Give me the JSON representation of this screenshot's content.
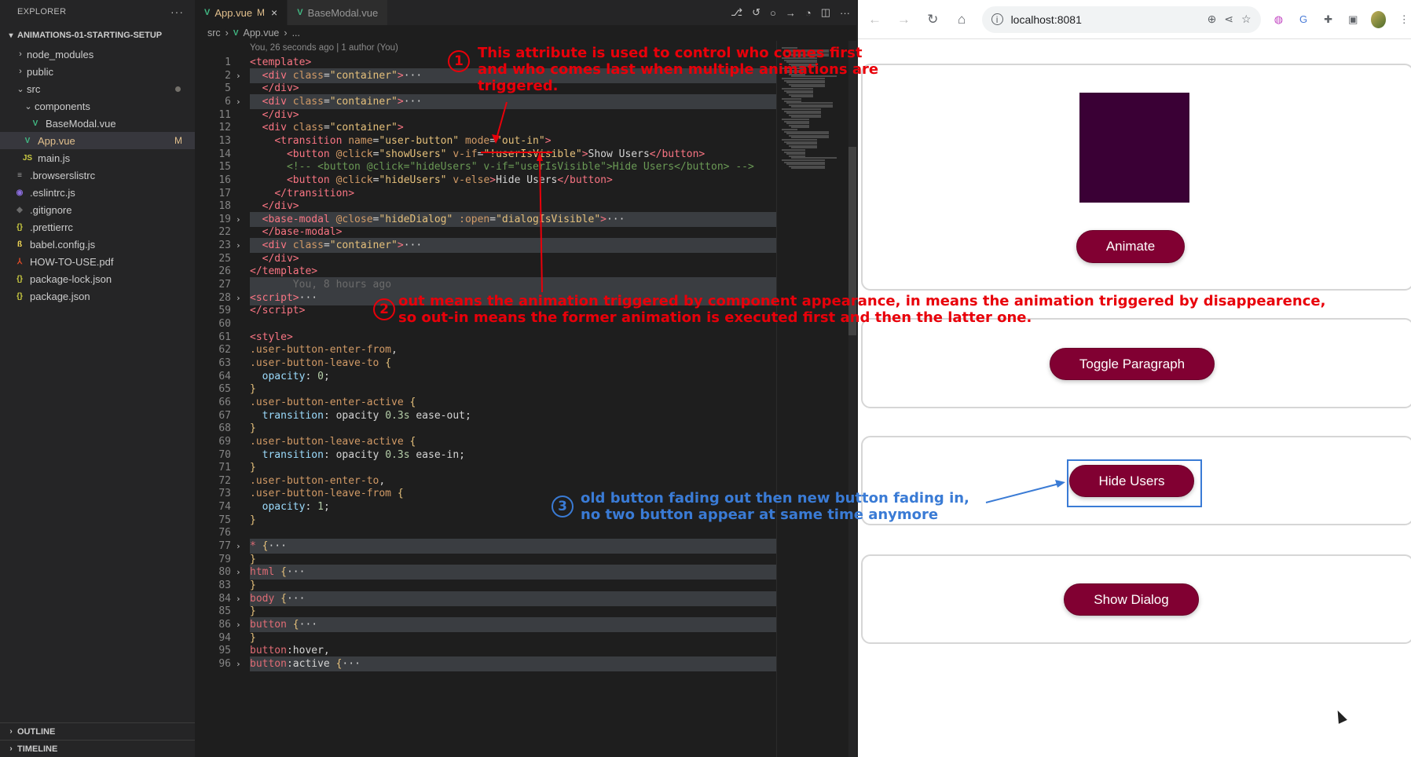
{
  "sidebar": {
    "title": "EXPLORER",
    "project": "ANIMATIONS-01-STARTING-SETUP",
    "items": [
      {
        "label": "node_modules",
        "type": "folder",
        "depth": 1,
        "open": false
      },
      {
        "label": "public",
        "type": "folder",
        "depth": 1,
        "open": false
      },
      {
        "label": "src",
        "type": "folder",
        "depth": 1,
        "open": true,
        "vue": true
      },
      {
        "label": "components",
        "type": "folder",
        "depth": 2,
        "open": true
      },
      {
        "label": "BaseModal.vue",
        "type": "vue",
        "depth": 3
      },
      {
        "label": "App.vue",
        "type": "vue",
        "depth": 2,
        "selected": true,
        "badge": "M"
      },
      {
        "label": "main.js",
        "type": "js",
        "depth": 2
      },
      {
        "label": ".browserslistrc",
        "type": "conf",
        "depth": 1
      },
      {
        "label": ".eslintrc.js",
        "type": "eslint",
        "depth": 1
      },
      {
        "label": ".gitignore",
        "type": "git",
        "depth": 1
      },
      {
        "label": ".prettierrc",
        "type": "json",
        "depth": 1
      },
      {
        "label": "babel.config.js",
        "type": "babel",
        "depth": 1
      },
      {
        "label": "HOW-TO-USE.pdf",
        "type": "pdf",
        "depth": 1
      },
      {
        "label": "package-lock.json",
        "type": "json",
        "depth": 1
      },
      {
        "label": "package.json",
        "type": "json",
        "depth": 1
      }
    ],
    "outline": "OUTLINE",
    "timeline": "TIMELINE"
  },
  "tabs": [
    {
      "label": "App.vue",
      "modified": "M",
      "active": true
    },
    {
      "label": "BaseModal.vue",
      "active": false
    }
  ],
  "breadcrumb": {
    "folder": "src",
    "file": "App.vue",
    "more": "..."
  },
  "blame": "You, 26 seconds ago | 1 author (You)",
  "code": [
    {
      "n": "1",
      "h": "<span class=\"tg\">&lt;template&gt;</span>"
    },
    {
      "n": "2",
      "fold": true,
      "hl": true,
      "h": "  <span class=\"tg\">&lt;div</span> <span class=\"at\">class</span>=<span class=\"st\">\"container\"</span><span class=\"tg\">&gt;</span><span class=\"pu\">···</span>"
    },
    {
      "n": "5",
      "h": "  <span class=\"tg\">&lt;/div&gt;</span>"
    },
    {
      "n": "6",
      "fold": true,
      "hl": true,
      "h": "  <span class=\"tg\">&lt;div</span> <span class=\"at\">class</span>=<span class=\"st\">\"container\"</span><span class=\"tg\">&gt;</span><span class=\"pu\">···</span>"
    },
    {
      "n": "11",
      "h": "  <span class=\"tg\">&lt;/div&gt;</span>"
    },
    {
      "n": "12",
      "h": "  <span class=\"tg\">&lt;div</span> <span class=\"at\">class</span>=<span class=\"st\">\"container\"</span><span class=\"tg\">&gt;</span>"
    },
    {
      "n": "13",
      "h": "    <span class=\"tg\">&lt;transition</span> <span class=\"at\">name</span>=<span class=\"st\">\"user-button\"</span> <span class=\"at\">mode</span>=<span class=\"st\">\"out-in\"</span><span class=\"tg\">&gt;</span>"
    },
    {
      "n": "14",
      "h": "      <span class=\"tg\">&lt;button</span> <span class=\"at\">@click</span>=<span class=\"st\">\"showUsers\"</span> <span class=\"at\">v-if</span>=<span class=\"st\">\"!userIsVisible\"</span><span class=\"tg\">&gt;</span>Show Users<span class=\"tg\">&lt;/button&gt;</span>"
    },
    {
      "n": "15",
      "h": "      <span class=\"cm\">&lt;!-- &lt;button @click=\"hideUsers\" v-if=\"userIsVisible\"&gt;Hide Users&lt;/button&gt; --&gt;</span>"
    },
    {
      "n": "16",
      "h": "      <span class=\"tg\">&lt;button</span> <span class=\"at\">@click</span>=<span class=\"st\">\"hideUsers\"</span> <span class=\"at\">v-else</span><span class=\"tg\">&gt;</span>Hide Users<span class=\"tg\">&lt;/button&gt;</span>"
    },
    {
      "n": "17",
      "h": "    <span class=\"tg\">&lt;/transition&gt;</span>"
    },
    {
      "n": "18",
      "h": "  <span class=\"tg\">&lt;/div&gt;</span>"
    },
    {
      "n": "19",
      "fold": true,
      "hl": true,
      "h": "  <span class=\"tg\">&lt;base-modal</span> <span class=\"at\">@close</span>=<span class=\"st\">\"hideDialog\"</span> <span class=\"at\">:open</span>=<span class=\"st\">\"dialogIsVisible\"</span><span class=\"tg\">&gt;</span><span class=\"pu\">···</span>"
    },
    {
      "n": "22",
      "h": "  <span class=\"tg\">&lt;/base-modal&gt;</span>"
    },
    {
      "n": "23",
      "fold": true,
      "hl": true,
      "h": "  <span class=\"tg\">&lt;div</span> <span class=\"at\">class</span>=<span class=\"st\">\"container\"</span><span class=\"tg\">&gt;</span><span class=\"pu\">···</span>"
    },
    {
      "n": "25",
      "h": "  <span class=\"tg\">&lt;/div&gt;</span>"
    },
    {
      "n": "26",
      "h": "<span class=\"tg\">&lt;/template&gt;</span>"
    },
    {
      "n": "27",
      "hl": true,
      "h": "       <span style=\"color:#6b6b6b\">You, 8 hours ago</span>"
    },
    {
      "n": "28",
      "fold": true,
      "hl": true,
      "h": "<span class=\"tg\">&lt;script&gt;</span><span class=\"pu\">···</span>"
    },
    {
      "n": "59",
      "h": "<span class=\"tg\">&lt;/script&gt;</span>"
    },
    {
      "n": "60",
      "h": ""
    },
    {
      "n": "61",
      "h": "<span class=\"tg\">&lt;style&gt;</span>"
    },
    {
      "n": "62",
      "h": "<span class=\"at\">.user-button-enter-from</span>,"
    },
    {
      "n": "63",
      "h": "<span class=\"at\">.user-button-leave-to</span> <span class=\"st\">{</span>"
    },
    {
      "n": "64",
      "h": "  <span class=\"prop\">opacity</span>: <span class=\"num\">0</span>;"
    },
    {
      "n": "65",
      "h": "<span class=\"st\">}</span>"
    },
    {
      "n": "66",
      "h": "<span class=\"at\">.user-button-enter-active</span> <span class=\"st\">{</span>"
    },
    {
      "n": "67",
      "h": "  <span class=\"prop\">transition</span>: opacity <span class=\"num\">0.3s</span> ease-out;"
    },
    {
      "n": "68",
      "h": "<span class=\"st\">}</span>"
    },
    {
      "n": "69",
      "h": "<span class=\"at\">.user-button-leave-active</span> <span class=\"st\">{</span>"
    },
    {
      "n": "70",
      "h": "  <span class=\"prop\">transition</span>: opacity <span class=\"num\">0.3s</span> ease-in;"
    },
    {
      "n": "71",
      "h": "<span class=\"st\">}</span>"
    },
    {
      "n": "72",
      "h": "<span class=\"at\">.user-button-enter-to</span>,"
    },
    {
      "n": "73",
      "h": "<span class=\"at\">.user-button-leave-from</span> <span class=\"st\">{</span>"
    },
    {
      "n": "74",
      "h": "  <span class=\"prop\">opacity</span>: <span class=\"num\">1</span>;"
    },
    {
      "n": "75",
      "h": "<span class=\"st\">}</span>"
    },
    {
      "n": "76",
      "h": ""
    },
    {
      "n": "77",
      "fold": true,
      "hl": true,
      "h": "<span class=\"sel\">*</span> <span class=\"st\">{</span><span class=\"pu\">···</span>"
    },
    {
      "n": "79",
      "h": "<span class=\"st\">}</span>"
    },
    {
      "n": "80",
      "fold": true,
      "hl": true,
      "h": "<span class=\"sel\">html</span> <span class=\"st\">{</span><span class=\"pu\">···</span>"
    },
    {
      "n": "83",
      "h": "<span class=\"st\">}</span>"
    },
    {
      "n": "84",
      "fold": true,
      "hl": true,
      "h": "<span class=\"sel\">body</span> <span class=\"st\">{</span><span class=\"pu\">···</span>"
    },
    {
      "n": "85",
      "h": "<span class=\"st\">}</span>"
    },
    {
      "n": "86",
      "fold": true,
      "hl": true,
      "h": "<span class=\"sel\">button</span> <span class=\"st\">{</span><span class=\"pu\">···</span>"
    },
    {
      "n": "94",
      "h": "<span class=\"st\">}</span>"
    },
    {
      "n": "95",
      "h": "<span class=\"sel\">button</span>:hover,"
    },
    {
      "n": "96",
      "fold": true,
      "hl": true,
      "h": "<span class=\"sel\">button</span>:active <span class=\"st\">{</span><span class=\"pu\">···</span>"
    }
  ],
  "browser": {
    "url": "localhost:8081",
    "buttons": {
      "animate": "Animate",
      "toggle": "Toggle Paragraph",
      "users": "Hide Users",
      "dialog": "Show Dialog"
    }
  },
  "annotations": {
    "a1": {
      "num": "1",
      "text": "This attribute is used to control who comes first\nand who comes last when multiple animations are\ntriggered."
    },
    "a2": {
      "num": "2",
      "text": "out means the animation triggered by component appearance, in means the animation triggered by disappearence,\nso out-in means the former animation is executed first and then the latter one."
    },
    "a3": {
      "num": "3",
      "text": "old button fading out then new button fading in,\nno two button appear at same time anymore"
    }
  },
  "colors": {
    "accent_red": "#e8000a",
    "accent_blue": "#3a7bd5",
    "button_bg": "#810032",
    "block": "#3a0035"
  }
}
